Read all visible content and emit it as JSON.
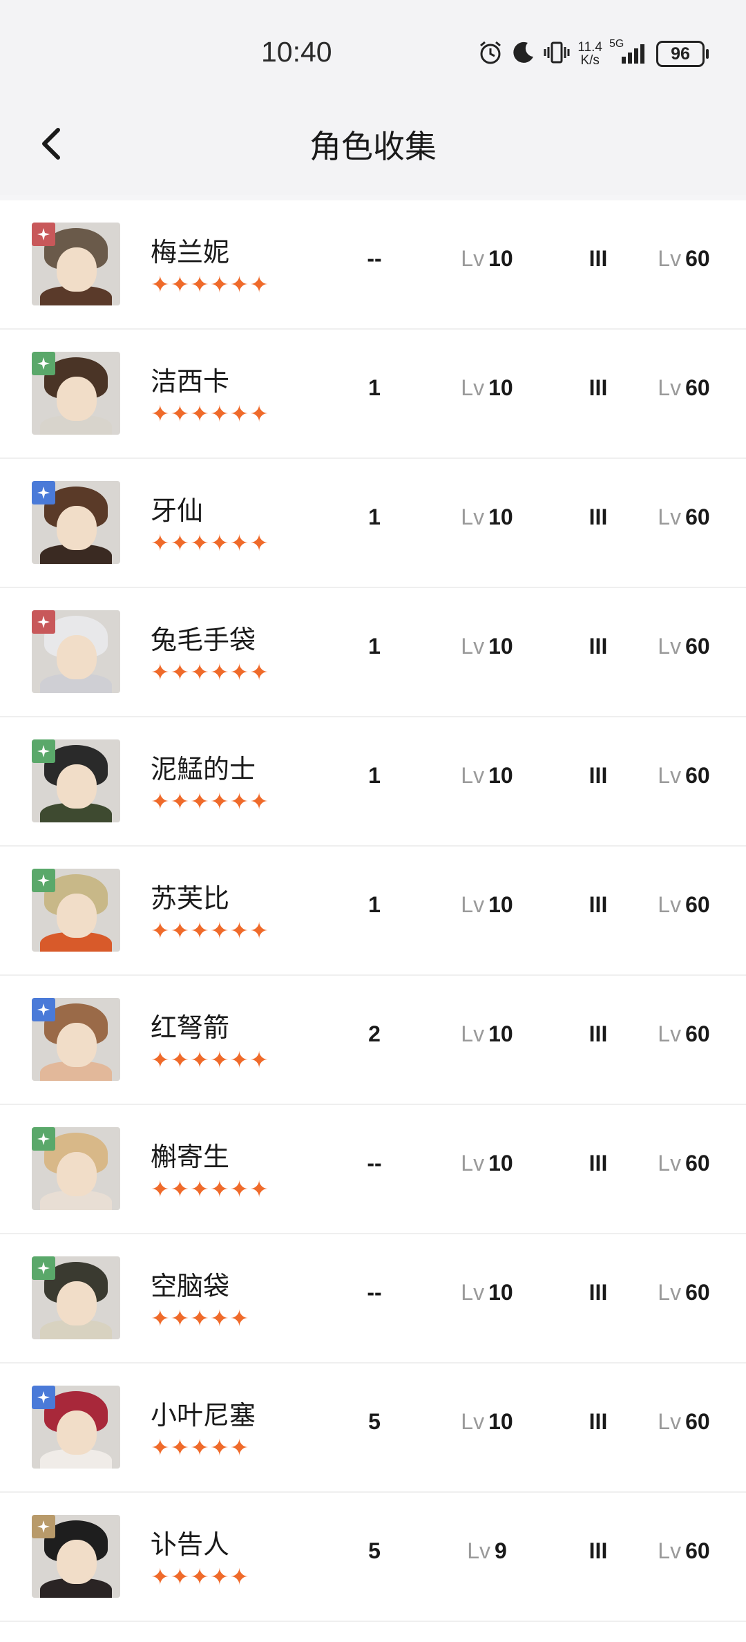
{
  "status_bar": {
    "time": "10:40",
    "speed_top": "11.4",
    "speed_bottom": "K/s",
    "network": "5G",
    "battery": "96"
  },
  "header": {
    "title": "角色收集"
  },
  "level_prefix": "Lv",
  "rows": [
    {
      "name": "梅兰妮",
      "stars": "✦✦✦✦✦✦",
      "col1": "--",
      "lv1": "10",
      "col3": "III",
      "lv2": "60",
      "badge": "red",
      "hair": "#6a5a4a",
      "body": "#5a3a2a"
    },
    {
      "name": "洁西卡",
      "stars": "✦✦✦✦✦✦",
      "col1": "1",
      "lv1": "10",
      "col3": "III",
      "lv2": "60",
      "badge": "green",
      "hair": "#4a3426",
      "body": "#d8d4cc"
    },
    {
      "name": "牙仙",
      "stars": "✦✦✦✦✦✦",
      "col1": "1",
      "lv1": "10",
      "col3": "III",
      "lv2": "60",
      "badge": "blue",
      "hair": "#5a3a28",
      "body": "#3a2a22"
    },
    {
      "name": "兔毛手袋",
      "stars": "✦✦✦✦✦✦",
      "col1": "1",
      "lv1": "10",
      "col3": "III",
      "lv2": "60",
      "badge": "red",
      "hair": "#e8e8ea",
      "body": "#cfcfd4"
    },
    {
      "name": "泥鯭的士",
      "stars": "✦✦✦✦✦✦",
      "col1": "1",
      "lv1": "10",
      "col3": "III",
      "lv2": "60",
      "badge": "green",
      "hair": "#2a2a2a",
      "body": "#3e4a30"
    },
    {
      "name": "苏芙比",
      "stars": "✦✦✦✦✦✦",
      "col1": "1",
      "lv1": "10",
      "col3": "III",
      "lv2": "60",
      "badge": "green",
      "hair": "#c8b888",
      "body": "#d85a2a"
    },
    {
      "name": "红弩箭",
      "stars": "✦✦✦✦✦✦",
      "col1": "2",
      "lv1": "10",
      "col3": "III",
      "lv2": "60",
      "badge": "blue",
      "hair": "#9a6a48",
      "body": "#e2b89a"
    },
    {
      "name": "槲寄生",
      "stars": "✦✦✦✦✦✦",
      "col1": "--",
      "lv1": "10",
      "col3": "III",
      "lv2": "60",
      "badge": "green",
      "hair": "#d8b888",
      "body": "#e8ded4"
    },
    {
      "name": "空脑袋",
      "stars": "✦✦✦✦✦",
      "col1": "--",
      "lv1": "10",
      "col3": "III",
      "lv2": "60",
      "badge": "green",
      "hair": "#3a3a30",
      "body": "#d8d2c0"
    },
    {
      "name": "小叶尼塞",
      "stars": "✦✦✦✦✦",
      "col1": "5",
      "lv1": "10",
      "col3": "III",
      "lv2": "60",
      "badge": "blue",
      "hair": "#a8283a",
      "body": "#f0ece8"
    },
    {
      "name": "讣告人",
      "stars": "✦✦✦✦✦",
      "col1": "5",
      "lv1": "9",
      "col3": "III",
      "lv2": "60",
      "badge": "gold",
      "hair": "#1e1e1e",
      "body": "#2a2424"
    }
  ],
  "badge_colors": {
    "red": "#c8585a",
    "green": "#5aa86a",
    "blue": "#4a7ad8",
    "gold": "#b89a6a"
  },
  "icons": {
    "back": "chevron-left-icon",
    "alarm": "alarm-icon",
    "moon": "moon-icon",
    "vibrate": "vibrate-icon",
    "signal": "signal-icon",
    "battery": "battery-icon"
  }
}
